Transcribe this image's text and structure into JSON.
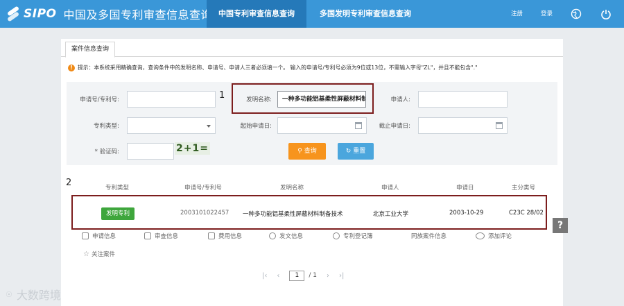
{
  "header": {
    "brand": "SIPO",
    "site_title": "中国及多国专利审查信息查询",
    "tabs": [
      {
        "label": "中国专利审查信息查询",
        "active": true
      },
      {
        "label": "多国发明专利审查信息查询",
        "active": false
      }
    ],
    "register": "注册",
    "login": "登录",
    "colors": {
      "bar": "#3a97d8",
      "active_tab": "#2579b9"
    }
  },
  "panel": {
    "tab_label": "案件信息查询",
    "tip_text": "提示：本系统采用精确查询，查询条件中的发明名称、申请号、申请人三者必须填一个。 输入的申请号/专利号必须为9位或13位，不需输入字母\"ZL\"，并且不能包含\".\""
  },
  "form": {
    "app_no_label": "申请号/专利号:",
    "app_no_value": "",
    "invention_name_label": "发明名称:",
    "invention_name_value": "一种多功能铝基柔性屏蔽材料制",
    "applicant_label": "申请人:",
    "applicant_value": "",
    "patent_type_label": "专利类型:",
    "patent_type_value": "",
    "start_date_label": "起始申请日:",
    "start_date_value": "",
    "end_date_label": "截止申请日:",
    "end_date_value": "",
    "captcha_label": "* 验证码:",
    "captcha_value": "",
    "captcha_image_text": "2+1=",
    "search_label": "查询",
    "reset_label": "重置"
  },
  "annotations": {
    "marker_1": "1",
    "marker_2": "2"
  },
  "results": {
    "columns": [
      "专利类型",
      "申请号/专利号",
      "发明名称",
      "申请人",
      "申请日",
      "主分类号"
    ],
    "rows": [
      {
        "type": "发明专利",
        "app_no": "2003101022457",
        "name": "一种多功能铝基柔性屏蔽材料制备技术",
        "applicant": "北京工业大学",
        "date": "2003-10-29",
        "class": "C23C 28/02"
      }
    ],
    "actions": [
      "申请信息",
      "审查信息",
      "费用信息",
      "发文信息",
      "专利登记簿",
      "同族案件信息",
      "添加评论"
    ],
    "follow_label": "关注案件"
  },
  "pager": {
    "current": "1",
    "total": "/ 1"
  },
  "help_label": "?",
  "watermark": "大数跨境"
}
